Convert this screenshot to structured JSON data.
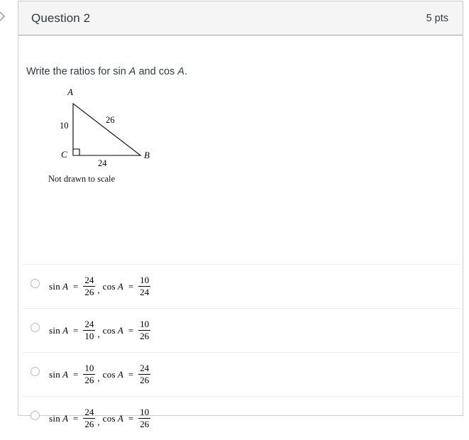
{
  "header": {
    "title": "Question 2",
    "points": "5 pts"
  },
  "collapse_icon": "chevron-right-icon",
  "question": {
    "prompt_before": "Write the ratios for sin ",
    "prompt_var1": "A",
    "prompt_middle": " and cos ",
    "prompt_var2": "A",
    "prompt_after": "."
  },
  "figure": {
    "vertex_a": "A",
    "vertex_b": "B",
    "vertex_c": "C",
    "leg_vertical": "10",
    "hypotenuse": "26",
    "leg_horizontal": "24",
    "caption": "Not drawn to scale"
  },
  "answers": [
    {
      "sin_label": "sin",
      "sin_var": "A",
      "sin_num": "24",
      "sin_den": "26",
      "cos_label": "cos",
      "cos_var": "A",
      "cos_num": "10",
      "cos_den": "24",
      "equals": "=",
      "comma": ","
    },
    {
      "sin_label": "sin",
      "sin_var": "A",
      "sin_num": "24",
      "sin_den": "10",
      "cos_label": "cos",
      "cos_var": "A",
      "cos_num": "10",
      "cos_den": "26",
      "equals": "=",
      "comma": ","
    },
    {
      "sin_label": "sin",
      "sin_var": "A",
      "sin_num": "10",
      "sin_den": "26",
      "cos_label": "cos",
      "cos_var": "A",
      "cos_num": "24",
      "cos_den": "26",
      "equals": "=",
      "comma": ","
    },
    {
      "sin_label": "sin",
      "sin_var": "A",
      "sin_num": "24",
      "sin_den": "26",
      "cos_label": "cos",
      "cos_var": "A",
      "cos_num": "10",
      "cos_den": "26",
      "equals": "=",
      "comma": ","
    }
  ],
  "colors": {
    "header_bg": "#f5f5f5",
    "card_border": "#c7cdd1",
    "text": "#2d3b45",
    "divider": "#e8eaec"
  }
}
